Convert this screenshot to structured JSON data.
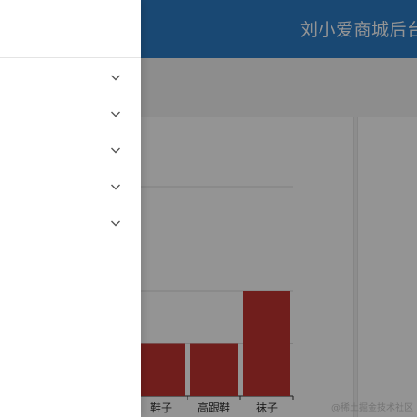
{
  "app": {
    "title": "刘小爱商城后台"
  },
  "drawer": {
    "items": [
      {
        "label": "",
        "icon": "chevron-down-icon"
      },
      {
        "label": "",
        "icon": "chevron-down-icon"
      },
      {
        "label": "",
        "icon": "chevron-down-icon"
      },
      {
        "label": "",
        "icon": "chevron-down-icon"
      },
      {
        "label": "",
        "icon": "chevron-down-icon"
      }
    ]
  },
  "chart_data": {
    "type": "bar",
    "categories": [
      "鞋子",
      "高跟鞋",
      "袜子"
    ],
    "values": [
      10,
      10,
      20
    ],
    "ylim": [
      0,
      40
    ],
    "grid": true,
    "color": "#c23531"
  },
  "watermark": {
    "text": "@稀土掘金技术社区"
  },
  "colors": {
    "header": "#2b7cc7",
    "mask": "rgba(0,0,0,0.42)",
    "bar": "#c23531"
  }
}
